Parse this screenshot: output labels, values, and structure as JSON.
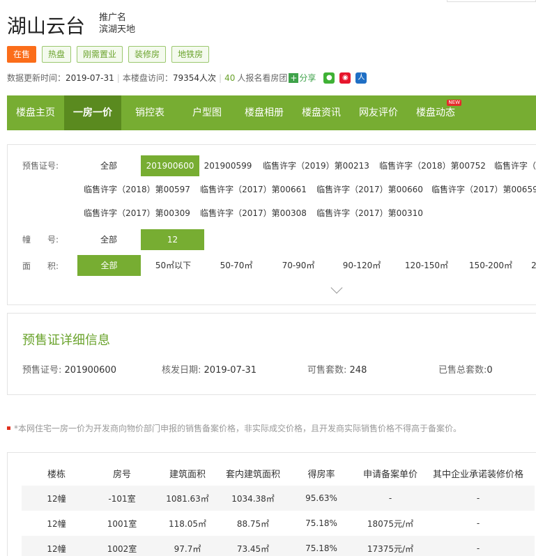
{
  "project": {
    "title": "湖山云台",
    "alias_label": "推广名",
    "alias_value": "滨湖天地"
  },
  "tags": [
    "在售",
    "热盘",
    "刚需置业",
    "装修房",
    "地铁房"
  ],
  "meta": {
    "update_label": "数据更新时间：",
    "update_date": "2019-07-31",
    "visits_label": "本楼盘访问：",
    "visits_value": "79354人次",
    "signup_count": "40",
    "signup_text": "人报名看房团",
    "share_label": "分享",
    "colors": {
      "accent": "#77ad32",
      "sale": "#fb6d1a"
    }
  },
  "nav": [
    "楼盘主页",
    "一房一价",
    "销控表",
    "户型图",
    "楼盘相册",
    "楼盘资讯",
    "网友评价",
    "楼盘动态"
  ],
  "nav_badge": "NEW",
  "filter": {
    "presale_label": "预售证号:",
    "presale_options": [
      "全部",
      "201900600",
      "201900599",
      "临售许字（2019）第00213",
      "临售许字（2018）第00752",
      "临售许字（",
      "临售许字（2018）第00597",
      "临售许字（2017）第00661",
      "临售许字（2017）第00660",
      "临售许字（2017）第00659",
      "临售许字（2017）第00309",
      "临售许字（2017）第00308",
      "临售许字（2017）第00310"
    ],
    "building_label": "幢　　号:",
    "building_options": [
      "全部",
      "12"
    ],
    "area_label": "面　　积:",
    "area_options": [
      "全部",
      "50㎡以下",
      "50-70㎡",
      "70-90㎡",
      "90-120㎡",
      "120-150㎡",
      "150-200㎡",
      "2"
    ]
  },
  "detail": {
    "title": "预售证详细信息",
    "presale_label": "预售证号:",
    "presale_value": "201900600",
    "issue_label": "核发日期:",
    "issue_value": "2019-07-31",
    "avail_label": "可售套数:",
    "avail_value": "248",
    "sold_label": "已售总套数:",
    "sold_value": "0"
  },
  "note": "*本网住宅一房一价为开发商向物价部门申报的销售备案价格，非实际成交价格，且开发商实际销售价格不得高于备案价。",
  "table": {
    "headers": [
      "楼栋",
      "房号",
      "建筑面积",
      "套内建筑面积",
      "得房率",
      "申请备案单价",
      "其中企业承诺装修价格"
    ],
    "rows": [
      [
        "12幢",
        "-101室",
        "1081.63㎡",
        "1034.38㎡",
        "95.63%",
        "-",
        "-"
      ],
      [
        "12幢",
        "1001室",
        "118.05㎡",
        "88.75㎡",
        "75.18%",
        "18075元/㎡",
        "-"
      ],
      [
        "12幢",
        "1002室",
        "97.7㎡",
        "73.45㎡",
        "75.18%",
        "17375元/㎡",
        "-"
      ]
    ]
  }
}
